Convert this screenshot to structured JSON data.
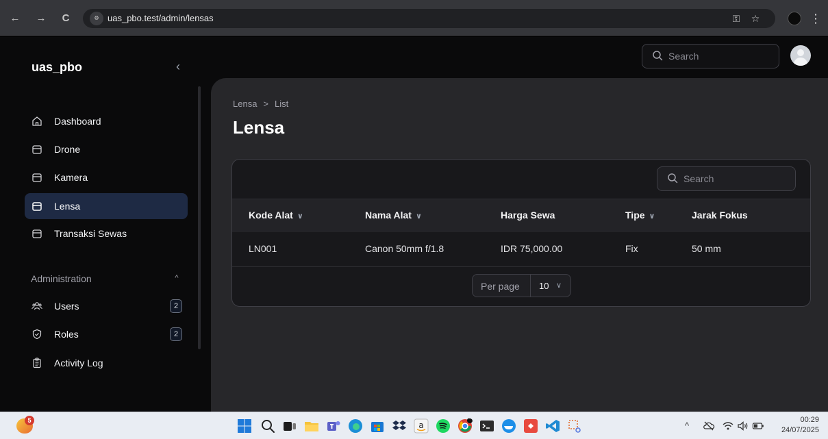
{
  "browser": {
    "url": "uas_pbo.test/admin/lensas",
    "back_icon": "←",
    "forward_icon": "→",
    "reload_icon": "C",
    "site_info_icon": "⚙",
    "key_icon": "⚿",
    "star_icon": "☆",
    "menu_icon": "⋮"
  },
  "app": {
    "brand": "uas_pbo",
    "collapse_icon": "‹",
    "topbar_search_placeholder": "Search"
  },
  "sidebar": {
    "items": [
      {
        "label": "Dashboard",
        "icon": "home-icon"
      },
      {
        "label": "Drone",
        "icon": "box-icon"
      },
      {
        "label": "Kamera",
        "icon": "box-icon"
      },
      {
        "label": "Lensa",
        "icon": "box-icon",
        "active": true
      },
      {
        "label": "Transaksi Sewas",
        "icon": "box-icon"
      }
    ],
    "group_label": "Administration",
    "group_chevron": "^",
    "admin_items": [
      {
        "label": "Users",
        "badge": "2",
        "icon": "users-icon"
      },
      {
        "label": "Roles",
        "badge": "2",
        "icon": "shield-icon"
      },
      {
        "label": "Activity Log",
        "icon": "clipboard-icon"
      }
    ]
  },
  "page": {
    "breadcrumb_parent": "Lensa",
    "breadcrumb_sep": ">",
    "breadcrumb_current": "List",
    "title": "Lensa"
  },
  "table": {
    "search_placeholder": "Search",
    "columns": [
      "Kode Alat",
      "Nama Alat",
      "Harga Sewa",
      "Tipe",
      "Jarak Fokus"
    ],
    "sort_chevron": "∨",
    "rows": [
      [
        "LN001",
        "Canon 50mm f/1.8",
        "IDR 75,000.00",
        "Fix",
        "50 mm"
      ]
    ],
    "per_page_label": "Per page",
    "per_page_value": "10",
    "per_page_chevron": "∨"
  },
  "taskbar": {
    "weather_badge": "5",
    "tray_chevron": "^",
    "time": "00:29",
    "date": "24/07/2025"
  }
}
